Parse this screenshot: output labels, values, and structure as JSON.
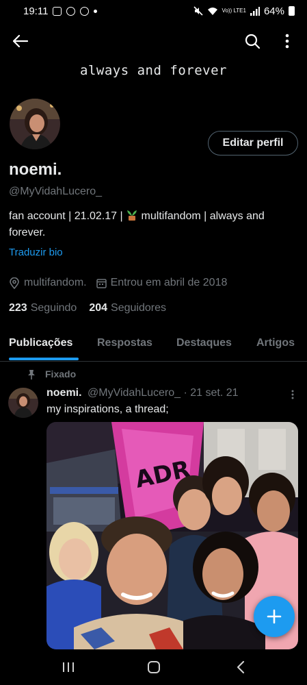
{
  "status_bar": {
    "time": "19:11",
    "network": "Vo)) LTE1",
    "battery": "64%"
  },
  "profile": {
    "banner_text": "always and forever",
    "edit_button": "Editar perfil",
    "display_name": "noemi.",
    "handle": "@MyVidahLucero_",
    "bio_part1": "fan account | 21.02.17 | ",
    "bio_part2": " multifandom | always and forever.",
    "translate_bio": "Traduzir bio",
    "location": "multifandom.",
    "joined": "Entrou em abril de 2018",
    "following_count": "223",
    "following_label": "Seguindo",
    "followers_count": "204",
    "followers_label": "Seguidores"
  },
  "tabs": [
    {
      "label": "Publicações",
      "active": true
    },
    {
      "label": "Respostas",
      "active": false
    },
    {
      "label": "Destaques",
      "active": false
    },
    {
      "label": "Artigos",
      "active": false
    }
  ],
  "pinned_tweet": {
    "pinned_label": "Fixado",
    "author_name": "noemi.",
    "author_handle": "@MyVidahLucero_",
    "date": "· 21 set. 21",
    "text": "my inspirations, a thread;"
  },
  "colors": {
    "background": "#000000",
    "accent": "#1d9bf0",
    "muted": "#71767b",
    "text": "#e7e9ea"
  },
  "icons": [
    "back-arrow-icon",
    "search-icon",
    "more-vertical-icon",
    "location-icon",
    "calendar-icon",
    "pin-icon",
    "more-icon",
    "plus-icon",
    "recent-apps-icon",
    "home-icon",
    "back-icon"
  ]
}
